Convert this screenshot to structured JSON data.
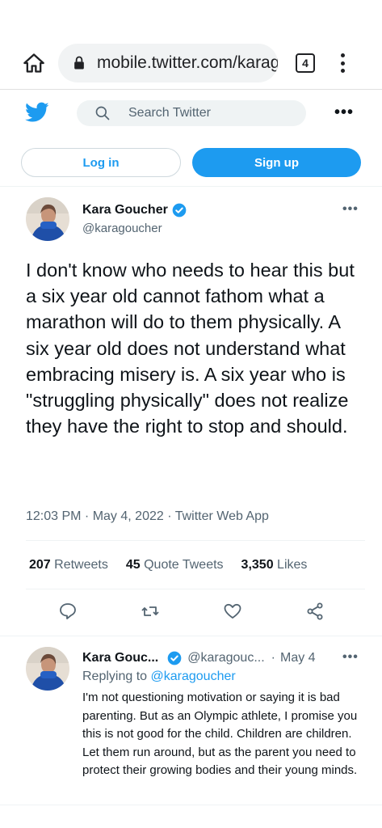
{
  "browser": {
    "url": "mobile.twitter.com/karagoucher",
    "tab_count": "4"
  },
  "header": {
    "search_placeholder": "Search Twitter",
    "more_label": "•••"
  },
  "auth": {
    "login_label": "Log in",
    "signup_label": "Sign up"
  },
  "tweet": {
    "author_name": "Kara Goucher",
    "author_handle": "@karagoucher",
    "more_label": "•••",
    "text": "I don't know who needs to hear this but a six year old cannot fathom what a marathon will do to them physically. A six year old does not understand what embracing misery is. A six year who is \"struggling physically\" does not realize they have the right to stop and should.",
    "meta": "12:03 PM · May 4, 2022 · Twitter Web App",
    "stats": {
      "retweets_count": "207",
      "retweets_label": "Retweets",
      "quotes_count": "45",
      "quotes_label": "Quote Tweets",
      "likes_count": "3,350",
      "likes_label": "Likes"
    }
  },
  "reply": {
    "author_name": "Kara Gouc...",
    "author_handle": "@karagouc...",
    "separator": "·",
    "date": "May 4",
    "more_label": "•••",
    "replying_prefix": "Replying to",
    "replying_mention": "@karagoucher",
    "text": "I'm not questioning motivation or saying it is bad parenting. But as an Olympic athlete, I promise you this is not good for the child. Children are children. Let them run around, but as the parent you need to protect their growing bodies and their young minds."
  },
  "colors": {
    "twitter_blue": "#1d9bf0",
    "text_primary": "#0f1419",
    "text_secondary": "#536471"
  },
  "icons": [
    "home-icon",
    "lock-icon",
    "kebab-menu-icon",
    "twitter-bird-icon",
    "search-icon",
    "verified-badge-icon",
    "reply-icon",
    "retweet-icon",
    "like-icon",
    "share-icon"
  ]
}
